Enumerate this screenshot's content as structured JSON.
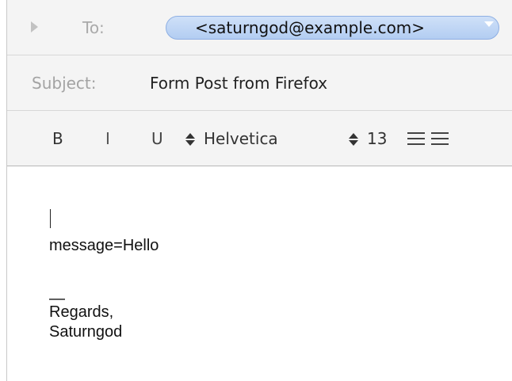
{
  "compose": {
    "to_label": "To:",
    "recipient": "<saturngod@example.com>",
    "subject_label": "Subject:",
    "subject": "Form Post from Firefox"
  },
  "format_bar": {
    "bold": "B",
    "italic": "I",
    "underline": "U",
    "font": "Helvetica",
    "size": "13",
    "icons": [
      "chevron-stepper-icon",
      "align-left-icon",
      "align-center-icon"
    ]
  },
  "body": {
    "message": "message=Hello",
    "signature_separator": "—",
    "regards": "Regards,",
    "name": "Saturngod"
  },
  "colors": {
    "recipient_token": "#b3cdf2",
    "label_gray": "#aaaaaa",
    "header_background": "#f4f4f4"
  }
}
